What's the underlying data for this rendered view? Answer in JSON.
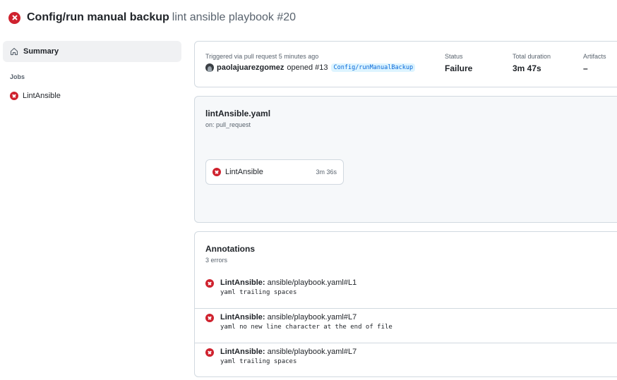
{
  "header": {
    "workflow": "Config/run manual backup",
    "run_name": "lint ansible playbook #20",
    "status_icon": "x-circle-fill-icon"
  },
  "sidebar": {
    "summary_label": "Summary",
    "jobs_label": "Jobs",
    "jobs": [
      {
        "name": "LintAnsible",
        "status": "failure"
      }
    ]
  },
  "meta": {
    "trigger_text": "Triggered via pull request 5 minutes ago",
    "user": "paolajuarezgomez",
    "opened_text": "opened #13",
    "branch": "Config/runManualBackup",
    "status_label": "Status",
    "status_value": "Failure",
    "duration_label": "Total duration",
    "duration_value": "3m 47s",
    "artifacts_label": "Artifacts",
    "artifacts_value": "–"
  },
  "workflow_graph": {
    "file": "lintAnsible.yaml",
    "on": "on: pull_request",
    "job_name": "LintAnsible",
    "job_duration": "3m 36s"
  },
  "annotations": {
    "title": "Annotations",
    "count": "3 errors",
    "items": [
      {
        "job": "LintAnsible:",
        "location": "ansible/playbook.yaml#L1",
        "message": "yaml trailing spaces"
      },
      {
        "job": "LintAnsible:",
        "location": "ansible/playbook.yaml#L7",
        "message": "yaml no new line character at the end of file"
      },
      {
        "job": "LintAnsible:",
        "location": "ansible/playbook.yaml#L7",
        "message": "yaml trailing spaces"
      }
    ]
  },
  "colors": {
    "failure": "#cf222e",
    "link": "#0969da",
    "muted": "#59636e",
    "border": "#d1d9e0"
  }
}
